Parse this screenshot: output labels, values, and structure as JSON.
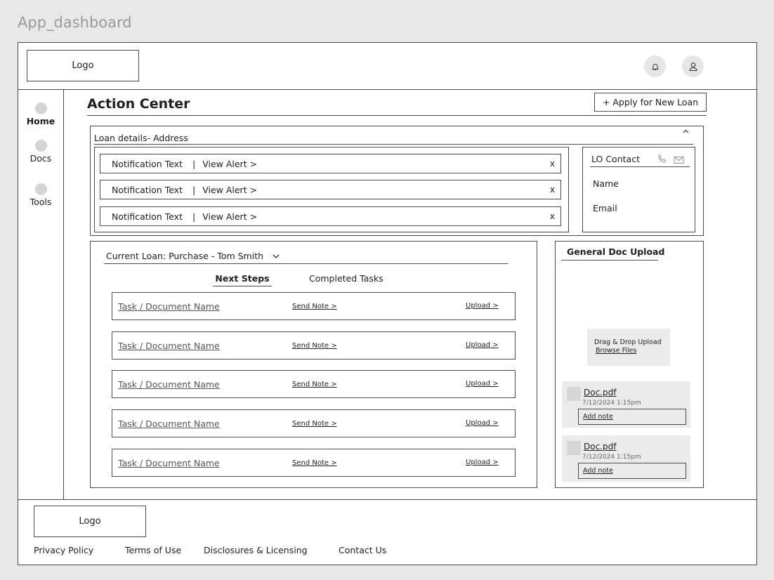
{
  "frame_title": "App_dashboard",
  "header": {
    "logo": "Logo",
    "icons": [
      "bell-icon",
      "user-icon"
    ]
  },
  "sidebar": {
    "items": [
      {
        "label": "Home",
        "active": true
      },
      {
        "label": "Docs",
        "active": false
      },
      {
        "label": "Tools",
        "active": false
      }
    ]
  },
  "main": {
    "title": "Action Center",
    "apply_button": "+ Apply for New Loan",
    "loan_details": {
      "label": "Loan details- Address",
      "collapse_glyph": "^",
      "notifications": [
        {
          "text": "Notification Text",
          "separator": "|",
          "link": "View Alert >",
          "close": "x"
        },
        {
          "text": "Notification Text",
          "separator": "|",
          "link": "View Alert >",
          "close": "x"
        },
        {
          "text": "Notification Text",
          "separator": "|",
          "link": "View Alert >",
          "close": "x"
        }
      ],
      "lo_contact": {
        "title": "LO Contact",
        "name": "Name",
        "email": "Email"
      }
    },
    "loan": {
      "selector": "Current Loan: Purchase - Tom Smith",
      "tabs": [
        {
          "label": "Next Steps",
          "active": true
        },
        {
          "label": "Completed Tasks",
          "active": false
        }
      ],
      "tasks": [
        {
          "name": "Task / Document Name",
          "send_note": "Send Note >",
          "upload": "Upload >"
        },
        {
          "name": "Task / Document Name",
          "send_note": "Send Note >",
          "upload": "Upload >"
        },
        {
          "name": "Task / Document Name",
          "send_note": "Send Note >",
          "upload": "Upload >"
        },
        {
          "name": "Task / Document Name",
          "send_note": "Send Note >",
          "upload": "Upload >"
        },
        {
          "name": "Task / Document Name",
          "send_note": "Send Note >",
          "upload": "Upload >"
        }
      ]
    },
    "upload": {
      "title": "General Doc Upload",
      "drop_text": "Drag & Drop Upload",
      "browse": "Browse Files",
      "docs": [
        {
          "name": "Doc.pdf",
          "date": "7/12/2024 1:15pm",
          "note": "Add note"
        },
        {
          "name": "Doc.pdf",
          "date": "7/12/2024 1:15pm",
          "note": "Add note"
        }
      ]
    }
  },
  "footer": {
    "logo": "Logo",
    "links": [
      "Privacy Policy",
      "Terms of Use",
      "Disclosures & Licensing",
      "Contact Us"
    ]
  },
  "colors": {
    "border": "#4a4a4a",
    "background": "#e8e8e8",
    "panel": "#ebebeb"
  }
}
